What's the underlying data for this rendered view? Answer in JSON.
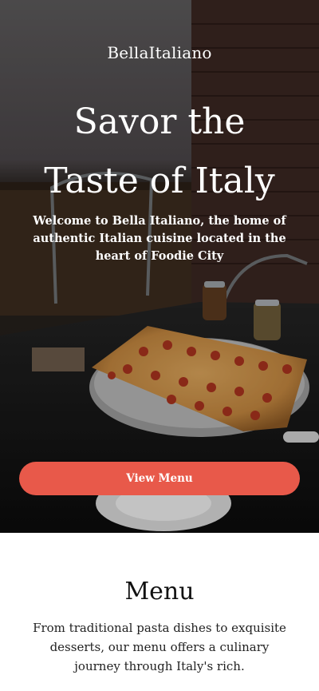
{
  "hero": {
    "brand": "BellaItaliano",
    "headline_line1": "Savor the",
    "headline_line2": "Taste of Italy",
    "intro": "Welcome to Bella Italiano, the home of authentic Italian cuisine located in the heart of Foodie City",
    "cta_label": "View Menu",
    "image_label": "pizza-on-table-photo"
  },
  "menu": {
    "title": "Menu",
    "description": "From traditional pasta dishes to exquisite desserts, our menu offers a culinary journey through Italy's rich."
  },
  "colors": {
    "accent": "#e8594a",
    "heading": "#111111",
    "text": "#222222"
  }
}
